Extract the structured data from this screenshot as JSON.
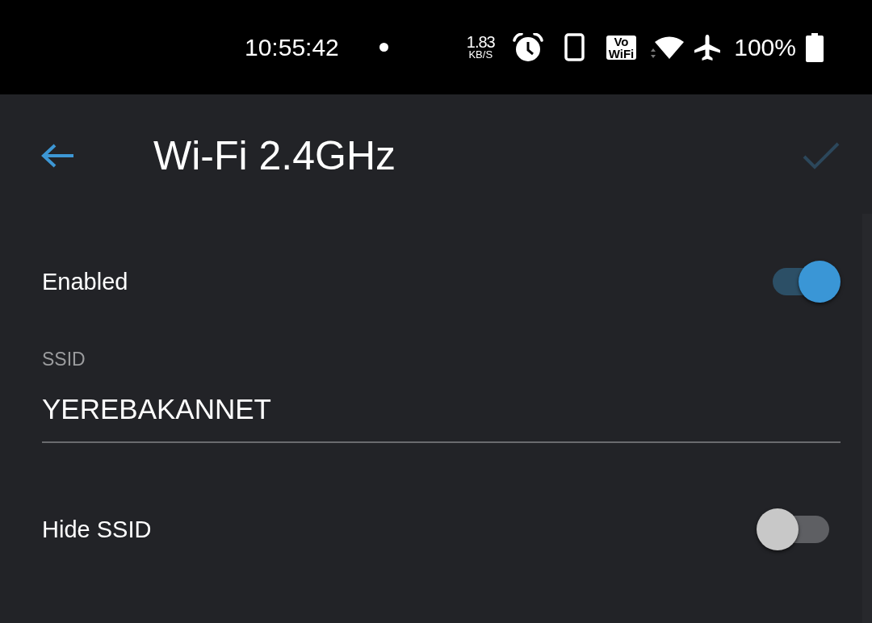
{
  "status_bar": {
    "time": "10:55:42",
    "net_speed_value": "1.83",
    "net_speed_unit": "KB/S",
    "vowifi_badge": [
      "Vo",
      "WiFi"
    ],
    "battery_text": "100%"
  },
  "header": {
    "title": "Wi-Fi 2.4GHz",
    "confirm_button": {
      "disabled": true
    }
  },
  "settings": [
    {
      "kind": "toggle",
      "label": "Enabled",
      "on": true
    },
    {
      "kind": "text_field",
      "label": "SSID",
      "value": "YEREBAKANNET"
    },
    {
      "kind": "toggle",
      "label": "Hide SSID",
      "on": false
    }
  ]
}
